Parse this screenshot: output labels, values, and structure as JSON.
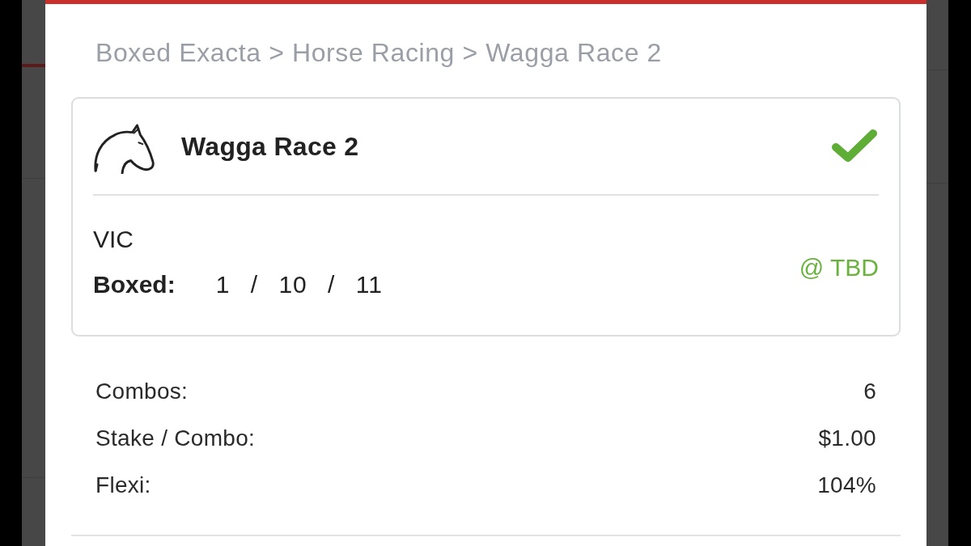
{
  "breadcrumb": "Boxed Exacta > Horse Racing > Wagga Race 2",
  "race": {
    "title": "Wagga Race 2",
    "checked": true,
    "state": "VIC",
    "selection_label": "Boxed:",
    "selection": "1 / 10 / 11",
    "odds": "@ TBD"
  },
  "summary": [
    {
      "label": "Combos:",
      "value": "6"
    },
    {
      "label": "Stake / Combo:",
      "value": "$1.00"
    },
    {
      "label": "Flexi:",
      "value": "104%"
    }
  ]
}
